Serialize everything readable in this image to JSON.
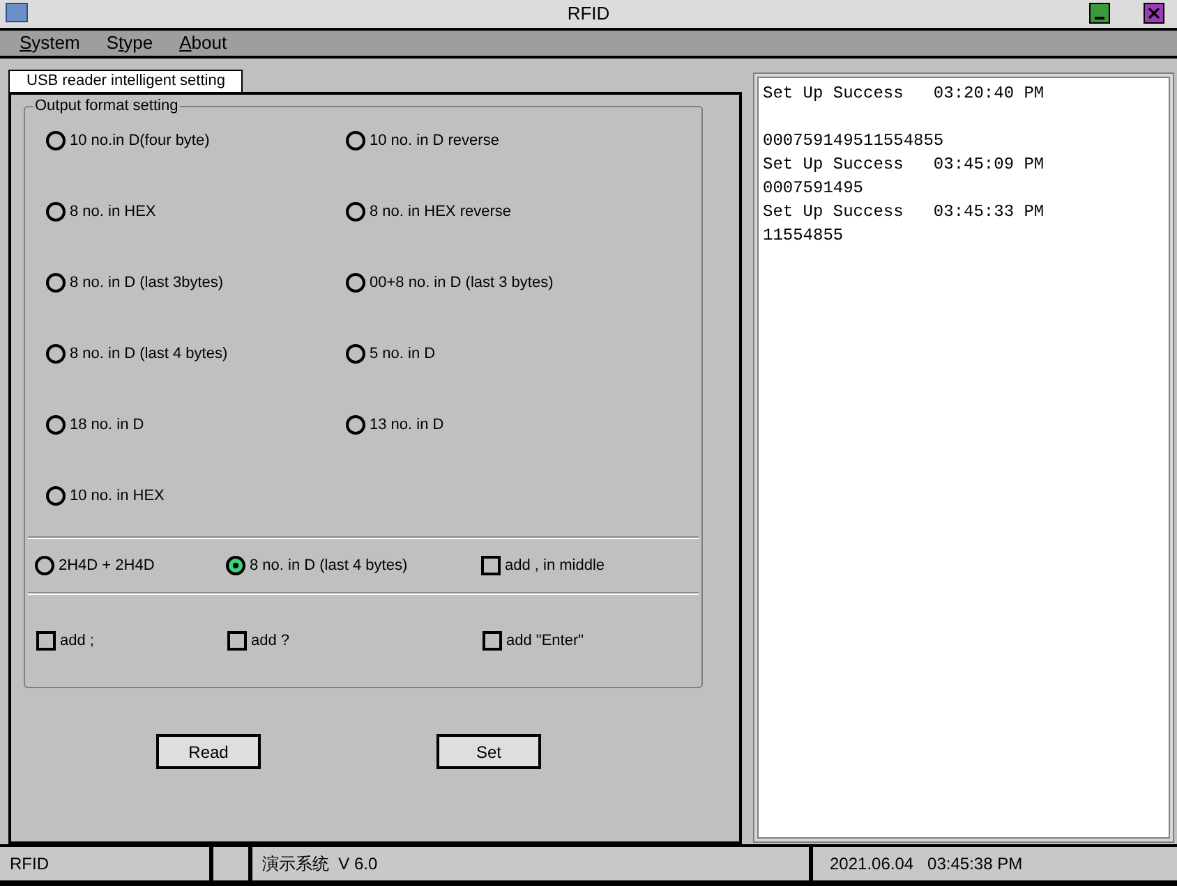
{
  "window": {
    "title": "RFID"
  },
  "menu": [
    {
      "accel": "S",
      "after": "ystem"
    },
    {
      "before": "S",
      "accel": "t",
      "after": "ype"
    },
    {
      "accel": "A",
      "after": "bout"
    }
  ],
  "tabs": [
    {
      "label": "USB reader intelligent setting",
      "selected": true
    }
  ],
  "output_format": {
    "title": "Output format setting",
    "options": [
      {
        "label": "10 no.in D(four byte)",
        "selected": false
      },
      {
        "label": "10 no. in D reverse",
        "selected": false
      },
      {
        "label": "8 no. in HEX",
        "selected": false
      },
      {
        "label": "8 no. in HEX reverse",
        "selected": false
      },
      {
        "label": "8 no. in D (last 3bytes)",
        "selected": false
      },
      {
        "label": "00+8 no. in D (last 3 bytes)",
        "selected": false
      },
      {
        "label": "8 no. in D (last 4 bytes)",
        "selected": false
      },
      {
        "label": "5 no. in D",
        "selected": false
      },
      {
        "label": "18 no. in D",
        "selected": false
      },
      {
        "label": "13 no. in D",
        "selected": false
      },
      {
        "label": "10 no. in HEX",
        "selected": false
      }
    ],
    "mode_row": [
      {
        "kind": "radio",
        "label": "2H4D + 2H4D",
        "selected": false
      },
      {
        "kind": "radio",
        "label": "8 no. in D (last 4 bytes)",
        "selected": true
      },
      {
        "kind": "checkbox",
        "label": "add , in middle",
        "checked": false
      }
    ],
    "suffix_row": [
      {
        "kind": "checkbox",
        "label": "add ;",
        "checked": false
      },
      {
        "kind": "checkbox",
        "label": "add ?",
        "checked": false
      },
      {
        "kind": "checkbox",
        "label": "add \"Enter\"",
        "checked": false
      }
    ]
  },
  "buttons": [
    "Read",
    "Set"
  ],
  "log": [
    "Set Up Success   03:20:40 PM",
    "000759149511554855",
    "Set Up Success   03:45:09 PM",
    "0007591495",
    "Set Up Success   03:45:33 PM",
    "11554855"
  ],
  "status_bar": {
    "app": "RFID",
    "version": "演示系统  V 6.0",
    "datetime": "2021.06.04   03:45:38 PM"
  }
}
